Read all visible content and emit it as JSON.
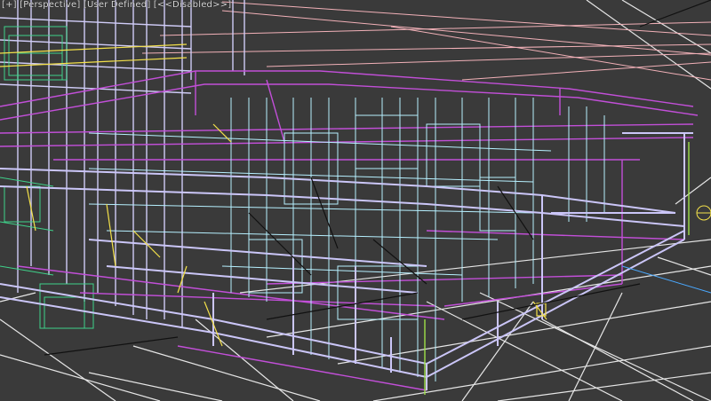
{
  "viewport": {
    "label": "[+] [Perspective] [User Defined] [<<Disabled>>]",
    "colors": {
      "background": "#3a3a3a",
      "grid": "#e9e9e9",
      "far_lines": "#f0b0b8",
      "magenta": "#c04bd6",
      "lavender": "#c9c4f5",
      "cyan": "#b6f0ff",
      "yellow": "#f4e14a",
      "green": "#3fd18a",
      "lime": "#a6e64b",
      "dark": "#111111",
      "blue": "#4aa9ff"
    }
  }
}
